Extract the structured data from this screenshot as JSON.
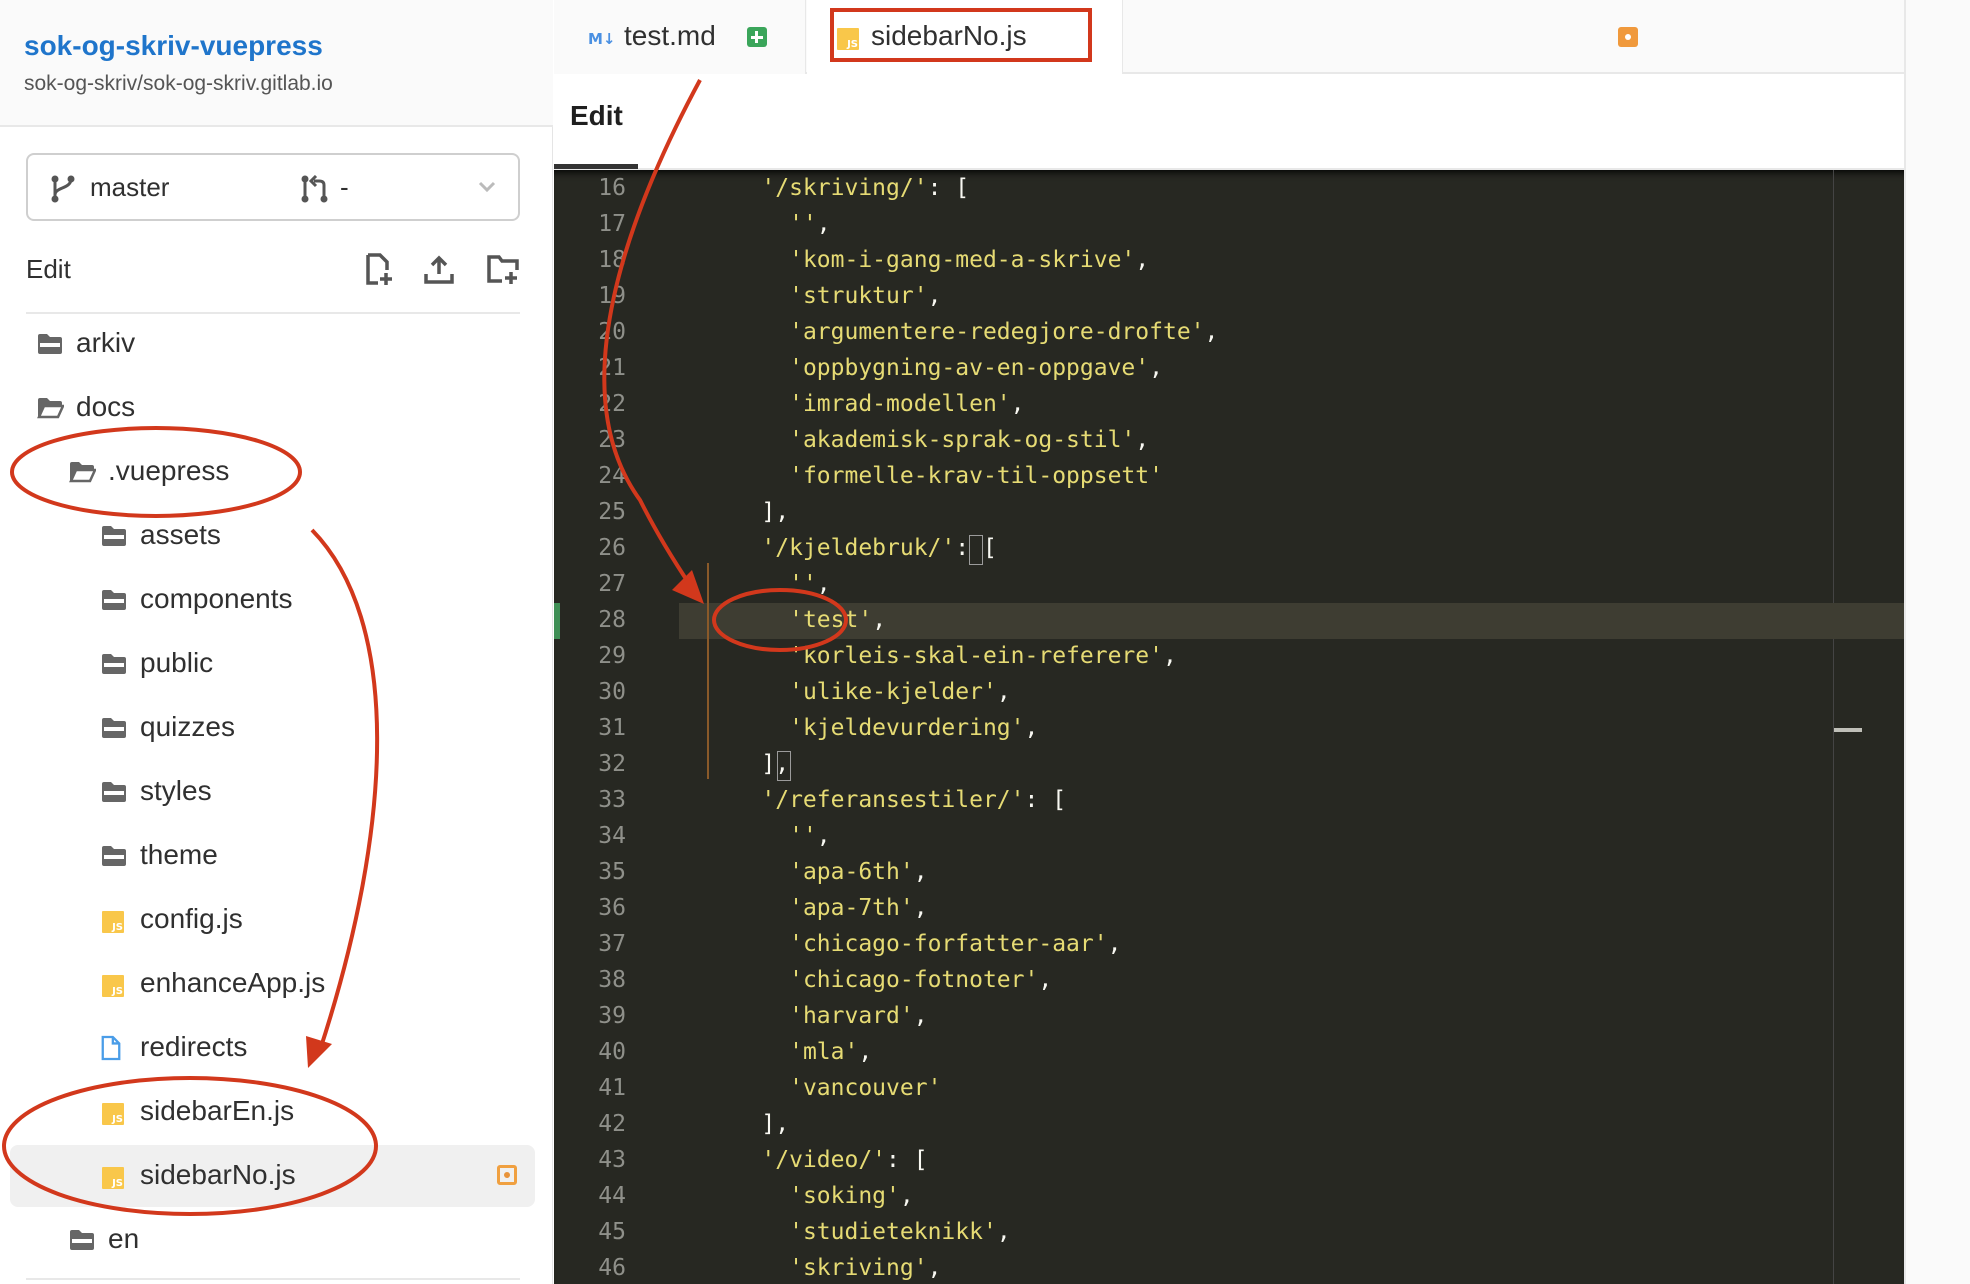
{
  "project": {
    "title": "sok-og-skriv-vuepress",
    "path": "sok-og-skriv/sok-og-skriv.gitlab.io"
  },
  "branch_selector": {
    "branch": "master",
    "merge_request": "-"
  },
  "sidebar_actions": {
    "label": "Edit",
    "icons": [
      "new-file-icon",
      "upload-icon",
      "new-folder-icon"
    ]
  },
  "tree": [
    {
      "name": "arkiv",
      "type": "folder",
      "level": 0
    },
    {
      "name": "docs",
      "type": "folder-open",
      "level": 0
    },
    {
      "name": ".vuepress",
      "type": "folder-open",
      "level": 1
    },
    {
      "name": "assets",
      "type": "folder",
      "level": 2
    },
    {
      "name": "components",
      "type": "folder",
      "level": 2
    },
    {
      "name": "public",
      "type": "folder",
      "level": 2
    },
    {
      "name": "quizzes",
      "type": "folder",
      "level": 2
    },
    {
      "name": "styles",
      "type": "folder",
      "level": 2
    },
    {
      "name": "theme",
      "type": "folder",
      "level": 2
    },
    {
      "name": "config.js",
      "type": "js",
      "level": 2
    },
    {
      "name": "enhanceApp.js",
      "type": "js",
      "level": 2
    },
    {
      "name": "redirects",
      "type": "file",
      "level": 2
    },
    {
      "name": "sidebarEn.js",
      "type": "js",
      "level": 2
    },
    {
      "name": "sidebarNo.js",
      "type": "js",
      "level": 2,
      "active": true,
      "modified": true
    },
    {
      "name": "en",
      "type": "folder",
      "level": 1
    }
  ],
  "tabs": [
    {
      "label": "test.md",
      "icon": "markdown-icon",
      "icon_text": "M↓",
      "status": "added"
    },
    {
      "label": "sidebarNo.js",
      "icon": "js-icon",
      "icon_text": "JS",
      "status": "modified",
      "active": true
    }
  ],
  "mode_tab": "Edit",
  "js_icon_text": "JS",
  "editor": {
    "current_line": 28,
    "changed_line": 28,
    "lines": [
      {
        "n": "16",
        "indent": "    ",
        "text": "'/skriving/'",
        "suffix": ": ["
      },
      {
        "n": "17",
        "indent": "      ",
        "text": "''",
        "suffix": ","
      },
      {
        "n": "18",
        "indent": "      ",
        "text": "'kom-i-gang-med-a-skrive'",
        "suffix": ","
      },
      {
        "n": "19",
        "indent": "      ",
        "text": "'struktur'",
        "suffix": ","
      },
      {
        "n": "20",
        "indent": "      ",
        "text": "'argumentere-redegjore-drofte'",
        "suffix": ","
      },
      {
        "n": "21",
        "indent": "      ",
        "text": "'oppbygning-av-en-oppgave'",
        "suffix": ","
      },
      {
        "n": "22",
        "indent": "      ",
        "text": "'imrad-modellen'",
        "suffix": ","
      },
      {
        "n": "23",
        "indent": "      ",
        "text": "'akademisk-sprak-og-stil'",
        "suffix": ","
      },
      {
        "n": "24",
        "indent": "      ",
        "text": "'formelle-krav-til-oppsett'",
        "suffix": ""
      },
      {
        "n": "25",
        "indent": "    ",
        "text": "",
        "suffix": "],"
      },
      {
        "n": "26",
        "indent": "    ",
        "text": "'/kjeldebruk/'",
        "suffix": ": ["
      },
      {
        "n": "27",
        "indent": "      ",
        "text": "''",
        "suffix": ","
      },
      {
        "n": "28",
        "indent": "      ",
        "text": "'test'",
        "suffix": ","
      },
      {
        "n": "29",
        "indent": "      ",
        "text": "'korleis-skal-ein-referere'",
        "suffix": ","
      },
      {
        "n": "30",
        "indent": "      ",
        "text": "'ulike-kjelder'",
        "suffix": ","
      },
      {
        "n": "31",
        "indent": "      ",
        "text": "'kjeldevurdering'",
        "suffix": ","
      },
      {
        "n": "32",
        "indent": "    ",
        "text": "",
        "suffix": "],"
      },
      {
        "n": "33",
        "indent": "    ",
        "text": "'/referansestiler/'",
        "suffix": ": ["
      },
      {
        "n": "34",
        "indent": "      ",
        "text": "''",
        "suffix": ","
      },
      {
        "n": "35",
        "indent": "      ",
        "text": "'apa-6th'",
        "suffix": ","
      },
      {
        "n": "36",
        "indent": "      ",
        "text": "'apa-7th'",
        "suffix": ","
      },
      {
        "n": "37",
        "indent": "      ",
        "text": "'chicago-forfatter-aar'",
        "suffix": ","
      },
      {
        "n": "38",
        "indent": "      ",
        "text": "'chicago-fotnoter'",
        "suffix": ","
      },
      {
        "n": "39",
        "indent": "      ",
        "text": "'harvard'",
        "suffix": ","
      },
      {
        "n": "40",
        "indent": "      ",
        "text": "'mla'",
        "suffix": ","
      },
      {
        "n": "41",
        "indent": "      ",
        "text": "'vancouver'",
        "suffix": ""
      },
      {
        "n": "42",
        "indent": "    ",
        "text": "",
        "suffix": "],"
      },
      {
        "n": "43",
        "indent": "    ",
        "text": "'/video/'",
        "suffix": ": ["
      },
      {
        "n": "44",
        "indent": "      ",
        "text": "'soking'",
        "suffix": ","
      },
      {
        "n": "45",
        "indent": "      ",
        "text": "'studieteknikk'",
        "suffix": ","
      },
      {
        "n": "46",
        "indent": "      ",
        "text": "'skriving'",
        "suffix": ","
      }
    ]
  },
  "annotation_color": "#d2381c",
  "colors": {
    "link_blue": "#1f75cb",
    "editor_bg": "#272822",
    "string": "#e6db74",
    "js_yellow": "#f9c74a",
    "added_green": "#3aa55a",
    "modified_orange": "#f0993c"
  }
}
